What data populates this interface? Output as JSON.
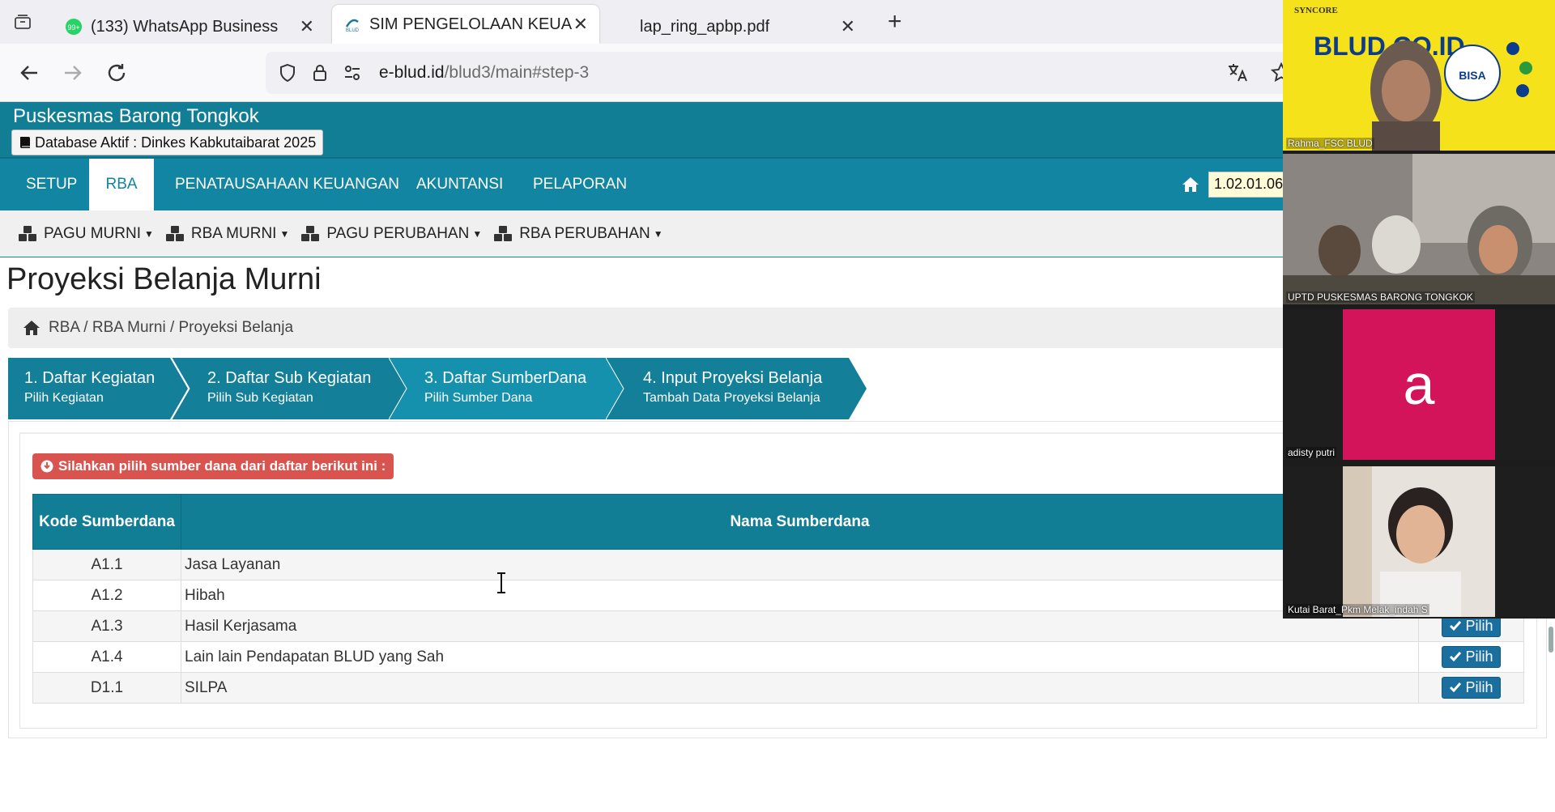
{
  "browser": {
    "tabs": [
      {
        "title": "(133) WhatsApp Business",
        "active": false
      },
      {
        "title": "SIM PENGELOLAAN KEUANGAN",
        "active": true
      },
      {
        "title": "lap_ring_apbp.pdf",
        "active": false
      }
    ],
    "url_host": "e-blud.id",
    "url_path": "/blud3/main#step-3"
  },
  "app": {
    "site_name": "Puskesmas Barong Tongkok",
    "db_badge": "Database Aktif : Dinkes Kabkutaibarat 2025",
    "main_nav": [
      "SETUP",
      "RBA",
      "PENATAUSAHAAN KEUANGAN",
      "AKUNTANSI",
      "PELAPORAN"
    ],
    "active_nav": "RBA",
    "org_code": "1.02.01.06 -",
    "sub_nav": [
      "PAGU MURNI",
      "RBA MURNI",
      "PAGU PERUBAHAN",
      "RBA PERUBAHAN"
    ]
  },
  "page": {
    "title": "Proyeksi Belanja Murni",
    "breadcrumb": "RBA / RBA Murni / Proyeksi Belanja"
  },
  "wizard": [
    {
      "title": "1. Daftar Kegiatan",
      "subtitle": "Pilih Kegiatan",
      "state": "done"
    },
    {
      "title": "2. Daftar Sub Kegiatan",
      "subtitle": "Pilih Sub Kegiatan",
      "state": "done"
    },
    {
      "title": "3. Daftar SumberDana",
      "subtitle": "Pilih Sumber Dana",
      "state": "current"
    },
    {
      "title": "4. Input Proyeksi Belanja",
      "subtitle": "Tambah Data Proyeksi Belanja",
      "state": "next"
    }
  ],
  "alert": "Silahkan pilih sumber dana dari daftar berikut ini :",
  "table": {
    "col_code": "Kode Sumberdana",
    "col_name": "Nama Sumberdana",
    "action_label": "Pilih",
    "rows": [
      {
        "code": "A1.1",
        "name": "Jasa Layanan"
      },
      {
        "code": "A1.2",
        "name": "Hibah"
      },
      {
        "code": "A1.3",
        "name": "Hasil Kerjasama"
      },
      {
        "code": "A1.4",
        "name": "Lain lain Pendapatan BLUD yang Sah"
      },
      {
        "code": "D1.1",
        "name": "SILPA"
      }
    ]
  },
  "video_call": {
    "participants": [
      {
        "name": "Rahma_FSC BLUD",
        "banner": "BLUD.CO.ID",
        "brand": "SYNCORE",
        "badge": "BISA",
        "banner_color": "#f5e21a"
      },
      {
        "name": "UPTD PUSKESMAS BARONG TONGKOK"
      },
      {
        "name": "adisty putri",
        "initial": "a",
        "avatar_color": "#d4145a"
      },
      {
        "name": "Kutai Barat_Pkm Melak_indah S"
      }
    ]
  }
}
